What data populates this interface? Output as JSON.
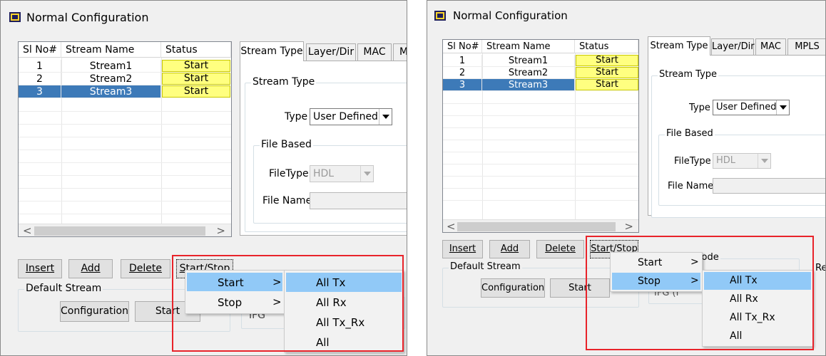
{
  "panels": [
    {
      "window_title": "Normal Configuration",
      "grid": {
        "headers": [
          "Sl No#",
          "Stream Name",
          "Status"
        ],
        "rows": [
          {
            "sl": "1",
            "name": "Stream1",
            "status": "Start",
            "selected": false
          },
          {
            "sl": "2",
            "name": "Stream2",
            "status": "Start",
            "selected": false
          },
          {
            "sl": "3",
            "name": "Stream3",
            "status": "Start",
            "selected": true
          }
        ]
      },
      "scroll": {
        "left": "<",
        "right": ">"
      },
      "tabs": [
        "Stream Type",
        "Layer/Dir",
        "MAC",
        "M"
      ],
      "stream_type_group": "Stream Type",
      "type_label": "Type",
      "type_value": "User Defined",
      "file_based_group": "File Based",
      "filetype_label": "FileType",
      "filetype_value": "HDL",
      "filename_label": "File Name",
      "buttons": {
        "insert": "Insert",
        "add": "Add",
        "delete": "Delete",
        "startstop": "Start/Stop"
      },
      "default_stream_group": "Default Stream",
      "configuration_button": "Configuration",
      "start_button": "Start",
      "partial_label": "IFG",
      "menu": {
        "items": [
          {
            "label": "Start",
            "chevron": ">"
          },
          {
            "label": "Stop",
            "chevron": ">"
          }
        ],
        "highlighted": "Start"
      },
      "submenu": {
        "items": [
          "All Tx",
          "All Rx",
          "All Tx_Rx",
          "All"
        ],
        "highlighted": "All Tx"
      }
    },
    {
      "window_title": "Normal Configuration",
      "grid": {
        "headers": [
          "Sl No#",
          "Stream Name",
          "Status"
        ],
        "rows": [
          {
            "sl": "1",
            "name": "Stream1",
            "status": "Start",
            "selected": false
          },
          {
            "sl": "2",
            "name": "Stream2",
            "status": "Start",
            "selected": false
          },
          {
            "sl": "3",
            "name": "Stream3",
            "status": "Start",
            "selected": true
          }
        ]
      },
      "scroll": {
        "left": "<",
        "right": ">"
      },
      "tabs": [
        "Stream Type",
        "Layer/Dir",
        "MAC",
        "MPLS"
      ],
      "stream_type_group": "Stream Type",
      "type_label": "Type",
      "type_value": "User Defined",
      "file_based_group": "File Based",
      "filetype_label": "FileType",
      "filetype_value": "HDL",
      "filename_label": "File Name",
      "buttons": {
        "insert": "Insert",
        "add": "Add",
        "delete": "Delete",
        "startstop": "Start/Stop"
      },
      "default_stream_group": "Default Stream",
      "configuration_button": "Configuration",
      "start_button": "Start",
      "partial_label": "eration Mode",
      "partial_label_2": "Re",
      "partial_label_3": "IFG (I",
      "menu": {
        "items": [
          {
            "label": "Start",
            "chevron": ">"
          },
          {
            "label": "Stop",
            "chevron": ">"
          }
        ],
        "highlighted": "Stop"
      },
      "submenu": {
        "items": [
          "All Tx",
          "All Rx",
          "All Tx_Rx",
          "All"
        ],
        "highlighted": "All Tx"
      }
    }
  ],
  "colors": {
    "selection": "#3d7ab8",
    "status_bg": "#ffff80",
    "menu_highlight": "#91c9f7",
    "callout": "#e8232a"
  }
}
